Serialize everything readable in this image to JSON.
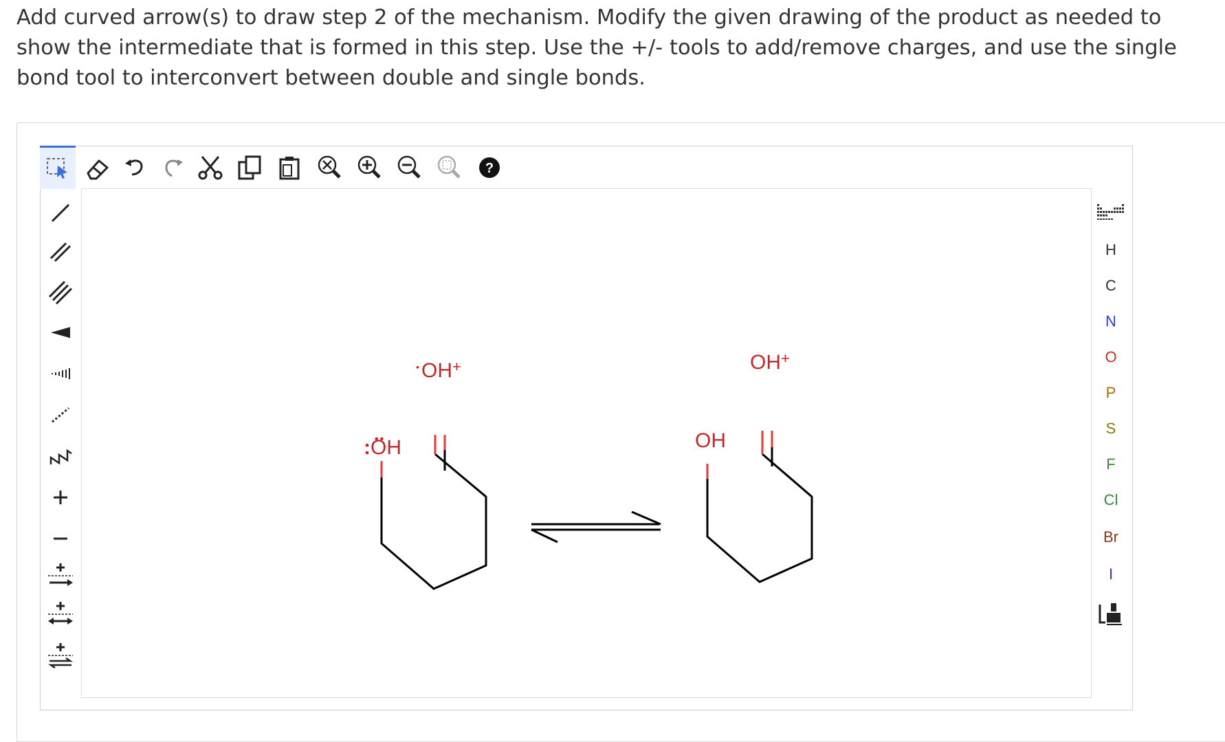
{
  "question": {
    "text": "Add curved arrow(s) to draw step 2 of the mechanism. Modify the given drawing of the product as needed to show the intermediate that is formed in this step. Use the +/- tools to add/remove charges, and use the single bond tool to interconvert between double and single bonds."
  },
  "top_toolbar": {
    "tools": [
      "select-tool-icon",
      "eraser-icon",
      "undo-icon",
      "redo-icon",
      "cut-icon",
      "copy-icon",
      "paste-icon",
      "zoom-fit-icon",
      "zoom-in-icon",
      "zoom-out-icon",
      "zoom-select-icon",
      "help-icon"
    ],
    "help_label": "?"
  },
  "left_toolbar": {
    "tools": [
      "single-bond-icon",
      "double-bond-icon",
      "triple-bond-icon",
      "wedge-bond-icon",
      "hash-bond-icon",
      "dashed-bond-icon",
      "chain-icon",
      "plus-charge-icon",
      "minus-charge-icon",
      "radical-arrow-icon",
      "reaction-arrow-icon",
      "resonance-arrow-icon",
      "equilibrium-arrow-icon"
    ]
  },
  "right_toolbar": {
    "periodic_table_icon": "periodic-table-icon",
    "elements": [
      "H",
      "C",
      "N",
      "O",
      "P",
      "S",
      "F",
      "Cl",
      "Br",
      "I"
    ],
    "element_colors": {
      "H": "#333333",
      "C": "#333333",
      "N": "#2a3fd6",
      "O": "#d62a2a",
      "P": "#b06a00",
      "S": "#8a7a00",
      "F": "#3a8a3a",
      "Cl": "#3a8a3a",
      "Br": "#8a3a1a",
      "I": "#5a2a8a"
    },
    "template_icon": "template-icon"
  },
  "molecules": {
    "reactant": {
      "hydroxyl_label": "OH",
      "hydroxyl_lone_pairs": ":",
      "oxonium_label": "OH",
      "oxonium_charge": "+"
    },
    "product": {
      "hydroxyl_label": "OH",
      "oxonium_label": "OH",
      "oxonium_charge": "+"
    },
    "arrow": "equilibrium-arrow"
  },
  "colors": {
    "accent": "#3b6fd4",
    "bond": "#000000",
    "heteroatom_bond": "#e53935",
    "oxygen": "#c62828",
    "text": "#333333"
  }
}
